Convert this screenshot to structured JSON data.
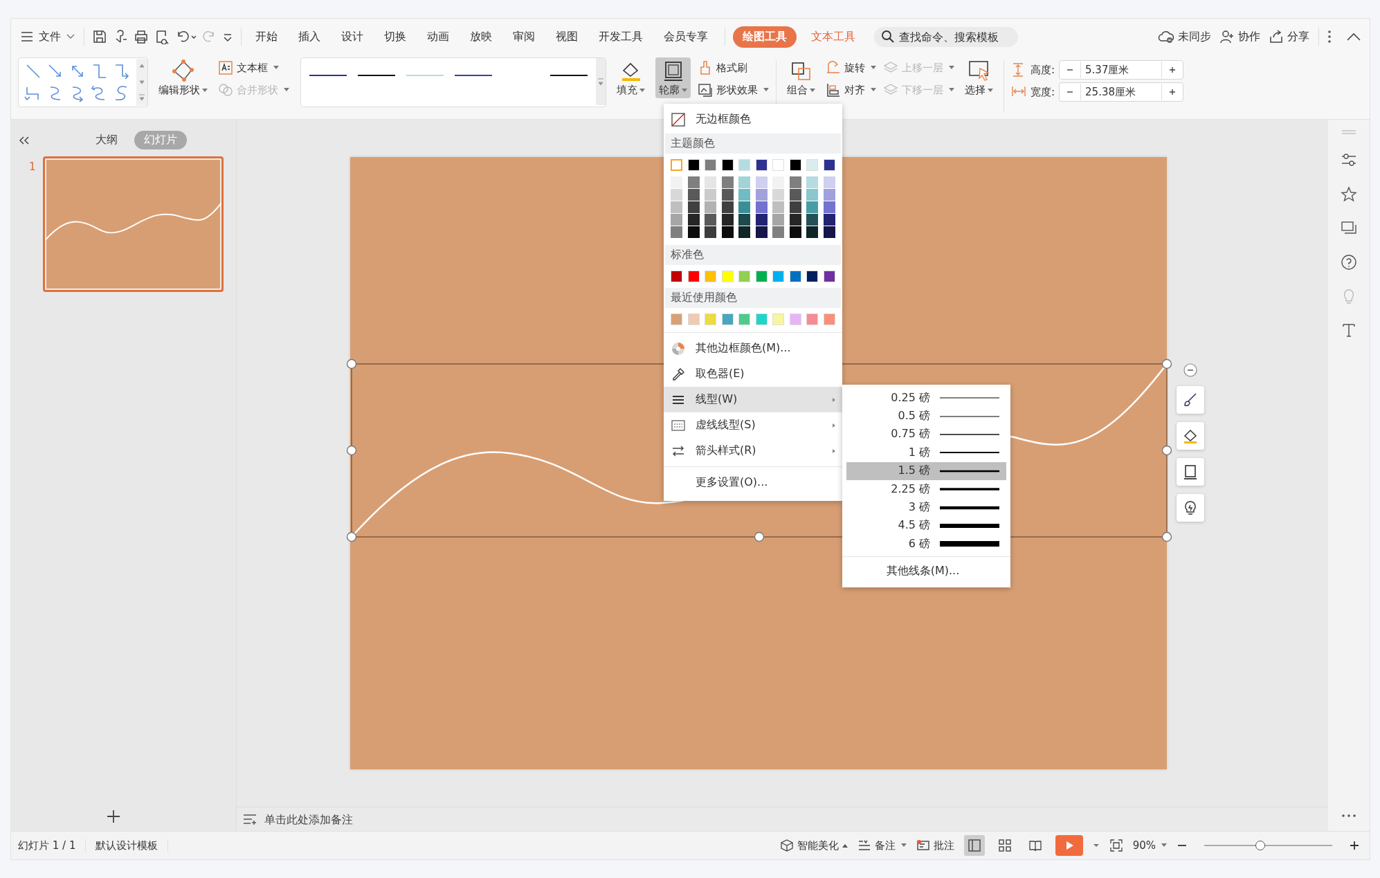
{
  "menubar": {
    "file_menu": "文件",
    "tabs": [
      {
        "label": "开始",
        "selected": false,
        "kind": "normal"
      },
      {
        "label": "插入",
        "selected": false,
        "kind": "normal"
      },
      {
        "label": "设计",
        "selected": false,
        "kind": "normal"
      },
      {
        "label": "切换",
        "selected": false,
        "kind": "normal"
      },
      {
        "label": "动画",
        "selected": false,
        "kind": "normal"
      },
      {
        "label": "放映",
        "selected": false,
        "kind": "normal"
      },
      {
        "label": "审阅",
        "selected": false,
        "kind": "normal"
      },
      {
        "label": "视图",
        "selected": false,
        "kind": "normal"
      },
      {
        "label": "开发工具",
        "selected": false,
        "kind": "normal"
      },
      {
        "label": "会员专享",
        "selected": false,
        "kind": "normal"
      },
      {
        "label": "绘图工具",
        "selected": true,
        "kind": "context"
      },
      {
        "label": "文本工具",
        "selected": false,
        "kind": "context"
      }
    ],
    "search": {
      "placeholder": "查找命令、搜索模板"
    },
    "sync_status": "未同步",
    "collaborate": "协作",
    "share": "分享"
  },
  "ribbon": {
    "edit_shape": "编辑形状",
    "text_box": "文本框",
    "merge_shapes": {
      "label": "合并形状",
      "disabled": true
    },
    "line_styles": [
      {
        "color": "#2e3192"
      },
      {
        "color": "#111111"
      },
      {
        "color": "#b4dde3"
      },
      {
        "color": "#3a3ea0"
      },
      {
        "color": "#111111"
      }
    ],
    "fill": "填充",
    "outline": {
      "label": "轮廓",
      "pressed": true
    },
    "format_painter": "格式刷",
    "shape_effects": "形状效果",
    "group": "组合",
    "rotate": "旋转",
    "align": "对齐",
    "bring_forward": {
      "label": "上移一层",
      "disabled": true
    },
    "send_backward": {
      "label": "下移一层",
      "disabled": true
    },
    "select": "选择",
    "height": {
      "label": "高度:",
      "value": "5.37厘米"
    },
    "width": {
      "label": "宽度:",
      "value": "25.38厘米"
    }
  },
  "panel": {
    "tabs": [
      {
        "label": "大纲",
        "selected": false
      },
      {
        "label": "幻灯片",
        "selected": true
      }
    ],
    "slides": [
      {
        "number": "1",
        "selected": true
      }
    ]
  },
  "notes": {
    "placeholder": "单击此处添加备注"
  },
  "outline_menu": {
    "no_border": "无边框颜色",
    "theme_title": "主题颜色",
    "theme_colors": [
      {
        "color": "#ffffff",
        "selected": true
      },
      {
        "color": "#000000",
        "selected": false
      },
      {
        "color": "#7f7f7f",
        "selected": false
      },
      {
        "color": "#000000",
        "selected": false
      },
      {
        "color": "#b4dde3",
        "selected": false
      },
      {
        "color": "#2e3192",
        "selected": false
      },
      {
        "color": "#ffffff",
        "selected": false
      },
      {
        "color": "#000000",
        "selected": false
      },
      {
        "color": "#d9ecee",
        "selected": false
      },
      {
        "color": "#2e3192",
        "selected": false
      }
    ],
    "theme_shades": [
      {
        "shades": [
          {
            "color": "#f2f2f2"
          },
          {
            "color": "#d9d9d9"
          },
          {
            "color": "#bfbfbf"
          },
          {
            "color": "#a6a6a6"
          },
          {
            "color": "#808080"
          }
        ]
      },
      {
        "shades": [
          {
            "color": "#7f7f7f"
          },
          {
            "color": "#595959"
          },
          {
            "color": "#404040"
          },
          {
            "color": "#262626"
          },
          {
            "color": "#0d0d0d"
          }
        ]
      },
      {
        "shades": [
          {
            "color": "#e5e5e5"
          },
          {
            "color": "#cbcbcb"
          },
          {
            "color": "#b2b2b2"
          },
          {
            "color": "#5a5a5a"
          },
          {
            "color": "#3c3c3c"
          }
        ]
      },
      {
        "shades": [
          {
            "color": "#7f7f7f"
          },
          {
            "color": "#595959"
          },
          {
            "color": "#404040"
          },
          {
            "color": "#262626"
          },
          {
            "color": "#0d0d0d"
          }
        ]
      },
      {
        "shades": [
          {
            "color": "#a1d4d9"
          },
          {
            "color": "#70bcc4"
          },
          {
            "color": "#3a8f97"
          },
          {
            "color": "#1e4a4e"
          },
          {
            "color": "#0f2527"
          }
        ]
      },
      {
        "shades": [
          {
            "color": "#cfcff0"
          },
          {
            "color": "#a1a1de"
          },
          {
            "color": "#7272cf"
          },
          {
            "color": "#232372"
          },
          {
            "color": "#16164a"
          }
        ]
      },
      {
        "shades": [
          {
            "color": "#f2f2f2"
          },
          {
            "color": "#d9d9d9"
          },
          {
            "color": "#bfbfbf"
          },
          {
            "color": "#a6a6a6"
          },
          {
            "color": "#808080"
          }
        ]
      },
      {
        "shades": [
          {
            "color": "#7f7f7f"
          },
          {
            "color": "#595959"
          },
          {
            "color": "#404040"
          },
          {
            "color": "#262626"
          },
          {
            "color": "#0d0d0d"
          }
        ]
      },
      {
        "shades": [
          {
            "color": "#b6dbe0"
          },
          {
            "color": "#8bc7ce"
          },
          {
            "color": "#489da5"
          },
          {
            "color": "#245157"
          },
          {
            "color": "#0f2528"
          }
        ]
      },
      {
        "shades": [
          {
            "color": "#cfcff0"
          },
          {
            "color": "#a1a1de"
          },
          {
            "color": "#7272cf"
          },
          {
            "color": "#232372"
          },
          {
            "color": "#16164a"
          }
        ]
      }
    ],
    "standard_title": "标准色",
    "standard_colors": [
      {
        "color": "#c00000"
      },
      {
        "color": "#ff0000"
      },
      {
        "color": "#ffc000"
      },
      {
        "color": "#ffff00"
      },
      {
        "color": "#92d050"
      },
      {
        "color": "#00b050"
      },
      {
        "color": "#00b0f0"
      },
      {
        "color": "#0070c0"
      },
      {
        "color": "#002060"
      },
      {
        "color": "#7030a0"
      }
    ],
    "recent_title": "最近使用颜色",
    "recent_colors": [
      {
        "color": "#d8a077"
      },
      {
        "color": "#eecbb1"
      },
      {
        "color": "#ecdc3c"
      },
      {
        "color": "#4aa6bd"
      },
      {
        "color": "#4ecb8b"
      },
      {
        "color": "#21d4ca"
      },
      {
        "color": "#f8f5a0"
      },
      {
        "color": "#e7b5f7"
      },
      {
        "color": "#f78b95"
      },
      {
        "color": "#f99079"
      }
    ],
    "items": [
      {
        "label": "其他边框颜色(M)...",
        "kind": "palette",
        "submenu": false,
        "selected": false
      },
      {
        "label": "取色器(E)",
        "kind": "eyedropper",
        "submenu": false,
        "selected": false
      },
      {
        "label": "线型(W)",
        "kind": "weights",
        "submenu": true,
        "selected": true
      },
      {
        "label": "虚线线型(S)",
        "kind": "dashes",
        "submenu": true,
        "selected": false
      },
      {
        "label": "箭头样式(R)",
        "kind": "arrows",
        "submenu": true,
        "selected": false
      },
      {
        "label": "更多设置(O)...",
        "kind": "plain",
        "submenu": false,
        "selected": false
      }
    ]
  },
  "line_weight_menu": {
    "items": [
      {
        "label": "0.25 磅",
        "selected": false
      },
      {
        "label": "0.5 磅",
        "selected": false
      },
      {
        "label": "0.75 磅",
        "selected": false
      },
      {
        "label": "1 磅",
        "selected": false
      },
      {
        "label": "1.5 磅",
        "selected": true
      },
      {
        "label": "2.25 磅",
        "selected": false
      },
      {
        "label": "3 磅",
        "selected": false
      },
      {
        "label": "4.5 磅",
        "selected": false
      },
      {
        "label": "6 磅",
        "selected": false
      }
    ],
    "more": "其他线条(M)..."
  },
  "status_bar": {
    "slide_counter": "幻灯片 1 / 1",
    "template": "默认设计模板",
    "beautify": "智能美化",
    "notes": "备注",
    "comments": "批注",
    "views": [
      {
        "kind": "normal",
        "selected": true
      },
      {
        "kind": "sorter",
        "selected": false
      },
      {
        "kind": "reading",
        "selected": false
      }
    ],
    "zoom": "90%",
    "zoom_slider": {
      "level": 0.44
    }
  }
}
